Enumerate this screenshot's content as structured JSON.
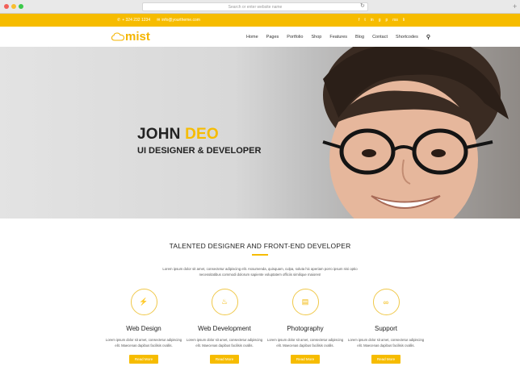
{
  "browser": {
    "address_placeholder": "Search or enter website name",
    "reload_icon": "↻",
    "new_tab_icon": "+"
  },
  "topbar": {
    "phone": "+ 324 232 1234",
    "email": "info@yourtheme.com",
    "social_icons": [
      "f",
      "t",
      "in",
      "g",
      "p",
      "rss",
      "li"
    ]
  },
  "nav": {
    "logo_text": "mist",
    "items": [
      "Home",
      "Pages",
      "Portfolio",
      "Shop",
      "Features",
      "Blog",
      "Contact",
      "Shortcodes"
    ],
    "search_icon": "search-icon"
  },
  "hero": {
    "first_name": "JOHN",
    "last_name": "DEO",
    "subtitle": "UI DESIGNER & DEVELOPER"
  },
  "section": {
    "title": "TALENTED DESIGNER AND FRONT-END DEVELOPER",
    "text": "Lorem ipsum dolor sit amet, consectetur adipiscing elit. Assumenda, quisquam, culpa, soluta hic aperiam porro ipsum nisi optio necessitatibus commodi dolorum sapiente voluptatem officiis similique maiores!"
  },
  "services": [
    {
      "name": "Web Design",
      "icon": "rocket-icon",
      "desc": "Lorem ipsum dolor sit amet, consectetur adipiscing elit. Maecenas dapibus facilisis cvallis.",
      "button": "Read More"
    },
    {
      "name": "Web Development",
      "icon": "fire-icon",
      "desc": "Lorem ipsum dolor sit amet, consectetur adipiscing elit. Maecenas dapibus facilisis cvallis.",
      "button": "Read More"
    },
    {
      "name": "Photography",
      "icon": "chat-icon",
      "desc": "Lorem ipsum dolor sit amet, consectetur adipiscing elit. Maecenas dapibus facilisis cvallis.",
      "button": "Read More"
    },
    {
      "name": "Support",
      "icon": "link-icon",
      "desc": "Lorem ipsum dolor sit amet, consectetur adipiscing elit. Maecenas dapibus facilisis cvallis.",
      "button": "Read More"
    }
  ],
  "colors": {
    "accent": "#f6bc00",
    "text_dark": "#222222"
  }
}
